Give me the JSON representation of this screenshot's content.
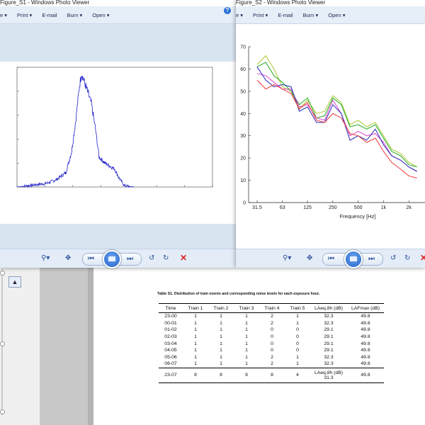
{
  "window1": {
    "title": "Figure_S1 - Windows Photo Viewer",
    "menu": [
      "e ▾",
      "Print ▾",
      "E-mail",
      "Burn ▾",
      "Open ▾"
    ],
    "help_icon": "help-icon"
  },
  "window2": {
    "title": "Figure_S2 - Windows Photo Viewer",
    "menu": [
      "e ▾",
      "Print ▾",
      "E-mail",
      "Burn ▾",
      "Open ▾"
    ]
  },
  "controls": {
    "icons": [
      "zoom-icon",
      "fit-icon",
      "previous-icon",
      "slideshow-icon",
      "next-icon",
      "rotate-ccw-icon",
      "rotate-cw-icon",
      "delete-icon"
    ],
    "colors": {
      "delete": "#dd2222",
      "slideshow": "#1f5fc8"
    }
  },
  "table": {
    "caption": "Table S1. Distribution of train events and corresponding noise levels for each exposure hour.",
    "headers": [
      "Time",
      "Train 1",
      "Train 2",
      "Train 3",
      "Train 4",
      "Train 5",
      "LAeq,8h (dB)",
      "LAFmax (dB)"
    ],
    "rows": [
      [
        "23-00",
        "1",
        "1",
        "1",
        "2",
        "1",
        "32.3",
        "49.8"
      ],
      [
        "00-01",
        "1",
        "1",
        "1",
        "2",
        "1",
        "32.3",
        "49.8"
      ],
      [
        "01-02",
        "1",
        "1",
        "1",
        "0",
        "0",
        "29.1",
        "49.8"
      ],
      [
        "02-03",
        "1",
        "1",
        "1",
        "0",
        "0",
        "29.1",
        "49.8"
      ],
      [
        "03-04",
        "1",
        "1",
        "1",
        "0",
        "0",
        "29.1",
        "49.8"
      ],
      [
        "04-05",
        "1",
        "1",
        "1",
        "0",
        "0",
        "29.1",
        "49.8"
      ],
      [
        "05-06",
        "1",
        "1",
        "1",
        "2",
        "1",
        "32.3",
        "49.8"
      ],
      [
        "06-07",
        "1",
        "1",
        "1",
        "2",
        "1",
        "32.3",
        "49.8"
      ]
    ],
    "total": {
      "time": "23-07",
      "t1": "8",
      "t2": "8",
      "t3": "8",
      "t4": "8",
      "t5": "4",
      "laeq_label": "LAeq,8h (dB)",
      "laeq_value": "31.3",
      "lafmax": "49.8"
    }
  },
  "chart_data": [
    {
      "type": "line",
      "title": "",
      "xlabel": "",
      "ylabel": "",
      "series": [
        {
          "color": "#2222cc",
          "points": [
            [
              0,
              0
            ],
            [
              0.05,
              0.01
            ],
            [
              0.1,
              0.02
            ],
            [
              0.15,
              0.03
            ],
            [
              0.2,
              0.06
            ],
            [
              0.25,
              0.12
            ],
            [
              0.28,
              0.3
            ],
            [
              0.3,
              0.55
            ],
            [
              0.32,
              0.85
            ],
            [
              0.33,
              0.95
            ],
            [
              0.35,
              0.85
            ],
            [
              0.38,
              0.7
            ],
            [
              0.4,
              0.5
            ],
            [
              0.42,
              0.25
            ],
            [
              0.45,
              0.2
            ],
            [
              0.48,
              0.17
            ],
            [
              0.5,
              0.15
            ],
            [
              0.52,
              0.08
            ],
            [
              0.55,
              0.01
            ],
            [
              0.6,
              0
            ]
          ]
        }
      ]
    },
    {
      "type": "line",
      "xlabel": "Frequency [Hz]",
      "ylabel": "",
      "ylim": [
        0,
        70
      ],
      "yticks": [
        "0",
        "10",
        "20",
        "30",
        "40",
        "50",
        "60",
        "70"
      ],
      "xticks": [
        "31.5",
        "63",
        "125",
        "250",
        "500",
        "1k",
        "2k"
      ],
      "x": [
        31.5,
        40,
        50,
        63,
        80,
        100,
        125,
        160,
        200,
        250,
        315,
        400,
        500,
        630,
        800,
        1000,
        1250,
        1600,
        2000,
        2500
      ],
      "series": [
        {
          "color": "#a8c830",
          "values": [
            62,
            66,
            60,
            52,
            50,
            42,
            46,
            40,
            41,
            48,
            45,
            35,
            37,
            34,
            36,
            30,
            24,
            22,
            18,
            16
          ]
        },
        {
          "color": "#22aa22",
          "values": [
            61,
            63,
            57,
            54,
            50,
            44,
            47,
            38,
            39,
            47,
            44,
            34,
            35,
            33,
            35,
            29,
            23,
            21,
            17,
            16
          ]
        },
        {
          "color": "#dd44cc",
          "values": [
            58,
            57,
            54,
            51,
            51,
            43,
            44,
            38,
            37,
            46,
            40,
            30,
            32,
            30,
            31,
            27,
            21,
            19,
            16,
            14
          ]
        },
        {
          "color": "#2a2ab8",
          "values": [
            61,
            55,
            52,
            53,
            52,
            41,
            43,
            36,
            36,
            44,
            40,
            28,
            30,
            28,
            33,
            26,
            21,
            19,
            16,
            14
          ]
        },
        {
          "color": "#ee3a3a",
          "values": [
            55,
            51,
            53,
            51,
            49,
            42,
            45,
            37,
            36,
            40,
            38,
            31,
            30,
            27,
            29,
            23,
            18,
            15,
            12,
            11
          ]
        }
      ]
    }
  ]
}
